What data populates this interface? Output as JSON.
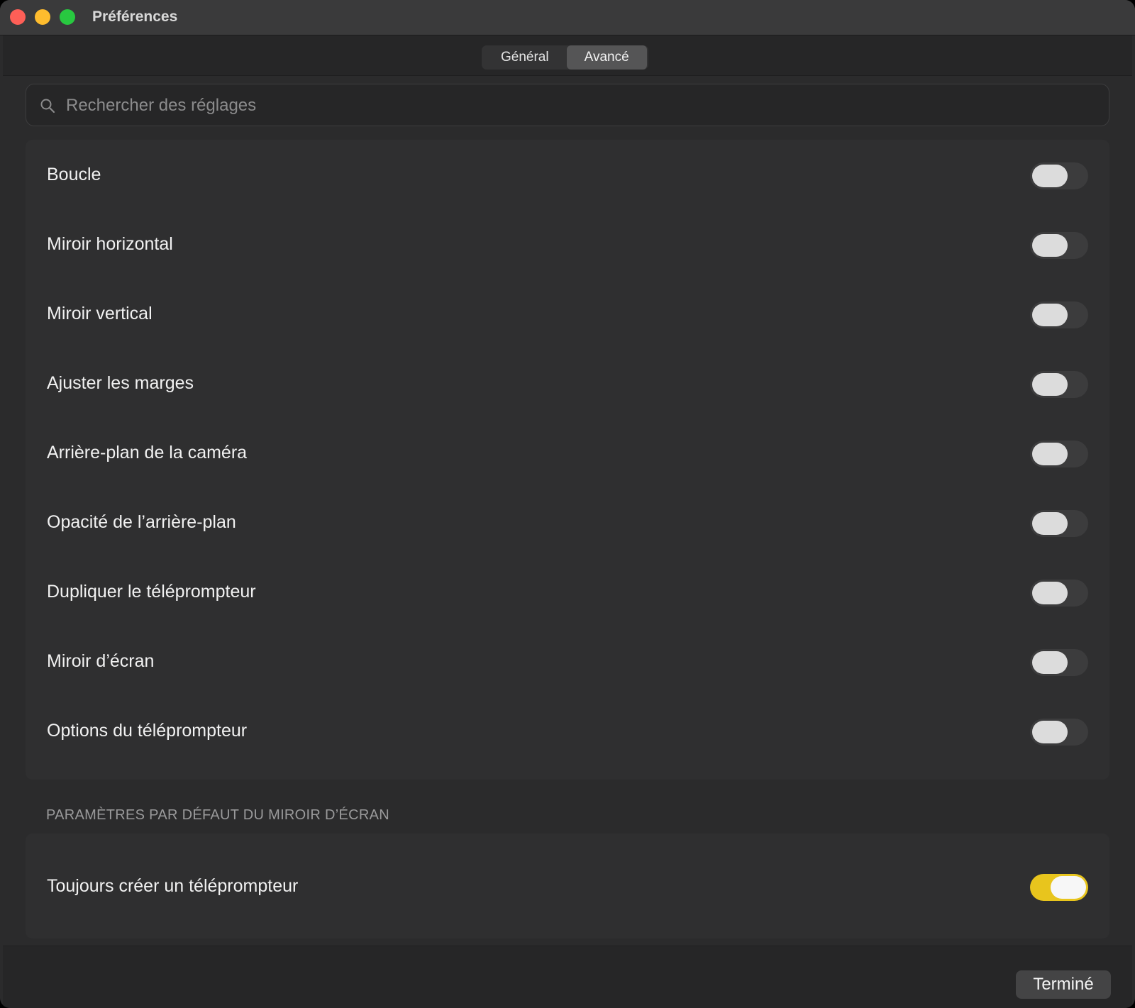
{
  "window": {
    "title": "Préférences"
  },
  "tabs": [
    {
      "label": "Général",
      "active": false
    },
    {
      "label": "Avancé",
      "active": true
    }
  ],
  "search": {
    "placeholder": "Rechercher des réglages",
    "value": ""
  },
  "settings": [
    {
      "label": "Boucle",
      "on": false
    },
    {
      "label": "Miroir horizontal",
      "on": false
    },
    {
      "label": "Miroir vertical",
      "on": false
    },
    {
      "label": "Ajuster les marges",
      "on": false
    },
    {
      "label": "Arrière-plan de la caméra",
      "on": false
    },
    {
      "label": "Opacité de l’arrière-plan",
      "on": false
    },
    {
      "label": "Dupliquer le téléprompteur",
      "on": false
    },
    {
      "label": "Miroir d’écran",
      "on": false
    },
    {
      "label": "Options du téléprompteur",
      "on": false
    }
  ],
  "mirror_defaults": {
    "header": "PARAMÈTRES PAR DÉFAUT DU MIROIR D’ÉCRAN",
    "items": [
      {
        "label": "Toujours créer un téléprompteur",
        "on": true
      }
    ]
  },
  "footer": {
    "done_label": "Terminé"
  },
  "colors": {
    "accent": "#e8c51d",
    "background": "#2b2b2c",
    "close": "#fe5f57",
    "minimize": "#febc2e",
    "maximize": "#28c840"
  }
}
